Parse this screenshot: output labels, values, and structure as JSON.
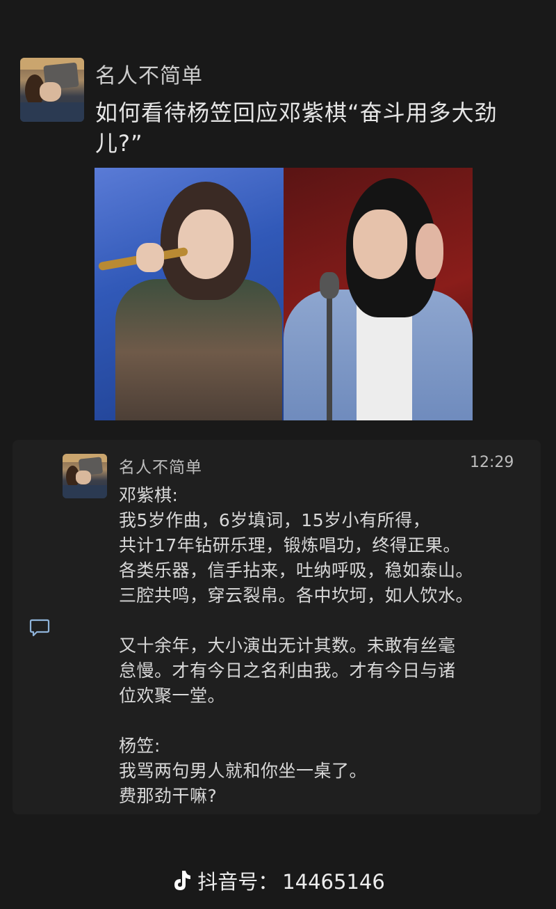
{
  "post": {
    "author": "名人不简单",
    "title": "如何看待杨笠回应邓紫棋“奋斗用多大劲儿?”"
  },
  "comment": {
    "author": "名人不简单",
    "time": "12:29",
    "lines": [
      "邓紫棋:",
      "我5岁作曲，6岁填词，15岁小有所得，",
      "共计17年钻研乐理，锻炼唱功，终得正果。",
      "各类乐器，信手拈来，吐纳呼吸，稳如泰山。",
      "三腔共鸣，穿云裂帛。各中坎坷，如人饮水。",
      "",
      "又十余年，大小演出无计其数。未敢有丝毫",
      "怠慢。才有今日之名利由我。才有今日与诸",
      "位欢聚一堂。",
      "",
      "杨笠:",
      "我骂两句男人就和你坐一桌了。",
      "费那劲干嘛?"
    ]
  },
  "footer": {
    "label": "抖音号：",
    "id": "14465146"
  }
}
